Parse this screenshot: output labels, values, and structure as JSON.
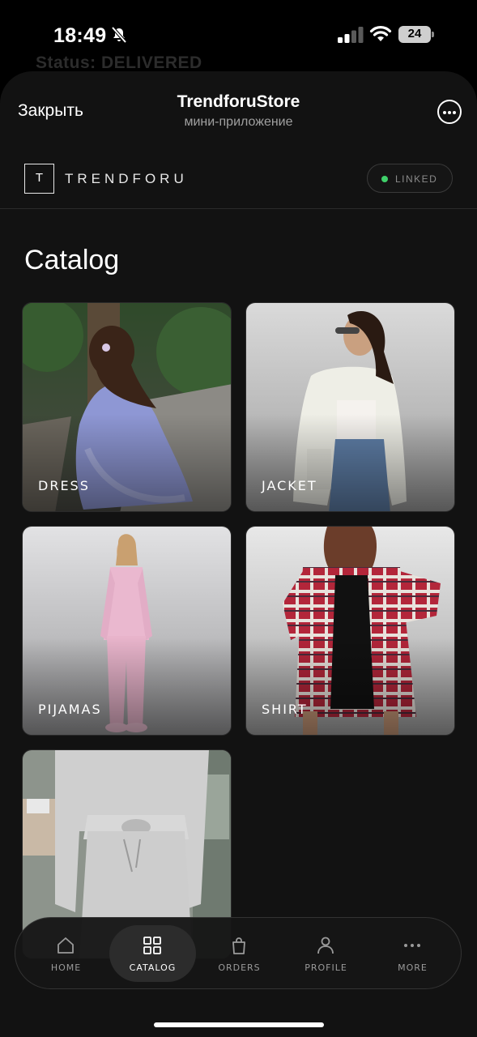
{
  "status_bar": {
    "time": "18:49",
    "battery": "24"
  },
  "behind_sheet_text": "Status: DELIVERED",
  "telegram_header": {
    "close_label": "Закрыть",
    "title": "TrendforuStore",
    "subtitle": "мини-приложение",
    "menu_icon": "more-circle-icon"
  },
  "app_header": {
    "logo_letter": "T",
    "logo_text": "TRENDFORU",
    "link_status": "LINKED",
    "link_status_color": "#3fd06a"
  },
  "page_title": "Catalog",
  "catalog": [
    {
      "label": "DRESS"
    },
    {
      "label": "JACKET"
    },
    {
      "label": "PIJAMAS"
    },
    {
      "label": "SHIRT"
    },
    {
      "label": ""
    }
  ],
  "bottom_nav": {
    "active": "CATALOG",
    "items": [
      {
        "label": "HOME",
        "icon": "home-icon"
      },
      {
        "label": "CATALOG",
        "icon": "grid-icon"
      },
      {
        "label": "ORDERS",
        "icon": "shopping-bag-icon"
      },
      {
        "label": "PROFILE",
        "icon": "user-icon"
      },
      {
        "label": "MORE",
        "icon": "dots-icon"
      }
    ]
  }
}
